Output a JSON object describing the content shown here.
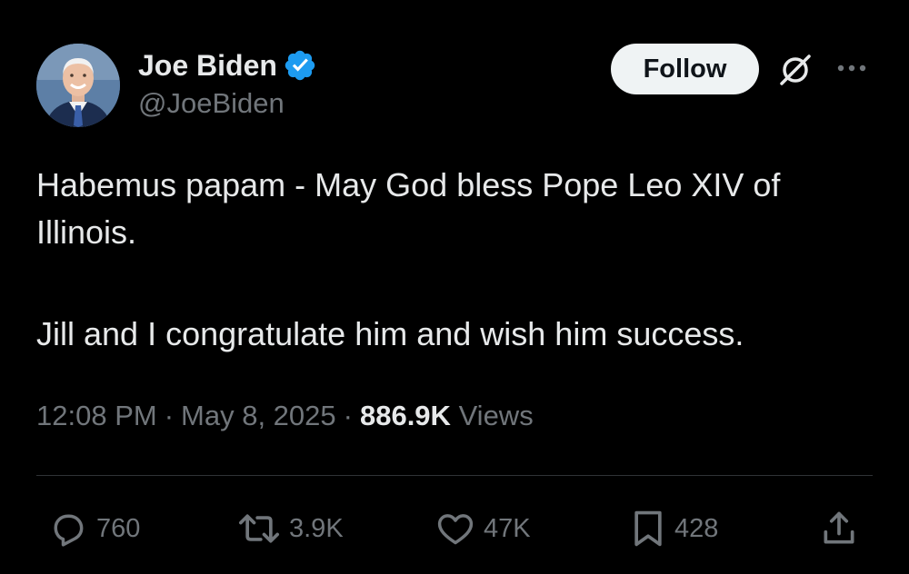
{
  "author": {
    "display_name": "Joe Biden",
    "handle": "@JoeBiden",
    "verified": true
  },
  "header": {
    "follow_label": "Follow",
    "grok_icon": "grok-icon",
    "more_icon": "more-icon"
  },
  "tweet": {
    "paragraphs": [
      "Habemus papam - May God bless Pope Leo XIV of Illinois.",
      "Jill and I congratulate him and wish him success."
    ]
  },
  "meta": {
    "time": "12:08 PM",
    "date": "May 8, 2025",
    "separator": "·",
    "views_count": "886.9K",
    "views_label": "Views"
  },
  "actions": {
    "replies": "760",
    "reposts": "3.9K",
    "likes": "47K",
    "bookmarks": "428"
  },
  "colors": {
    "background": "#000000",
    "text_primary": "#e7e9ea",
    "text_secondary": "#71767b",
    "verified_blue": "#1d9bf0",
    "follow_button_bg": "#eff3f4",
    "divider": "#2f3336"
  }
}
